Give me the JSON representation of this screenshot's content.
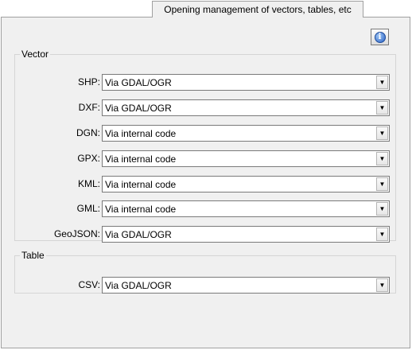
{
  "tab": {
    "label": "Opening management of vectors, tables, etc"
  },
  "info_button": {
    "icon": "info-icon",
    "glyph": "i"
  },
  "vector": {
    "title": "Vector",
    "rows": [
      {
        "label": "SHP:",
        "value": "Via GDAL/OGR"
      },
      {
        "label": "DXF:",
        "value": "Via GDAL/OGR"
      },
      {
        "label": "DGN:",
        "value": "Via internal code"
      },
      {
        "label": "GPX:",
        "value": "Via internal code"
      },
      {
        "label": "KML:",
        "value": "Via internal code"
      },
      {
        "label": "GML:",
        "value": "Via internal code"
      },
      {
        "label": "GeoJSON:",
        "value": "Via GDAL/OGR"
      }
    ]
  },
  "table": {
    "title": "Table",
    "rows": [
      {
        "label": "CSV:",
        "value": "Via GDAL/OGR"
      }
    ]
  },
  "dropdown_arrow": "▼"
}
